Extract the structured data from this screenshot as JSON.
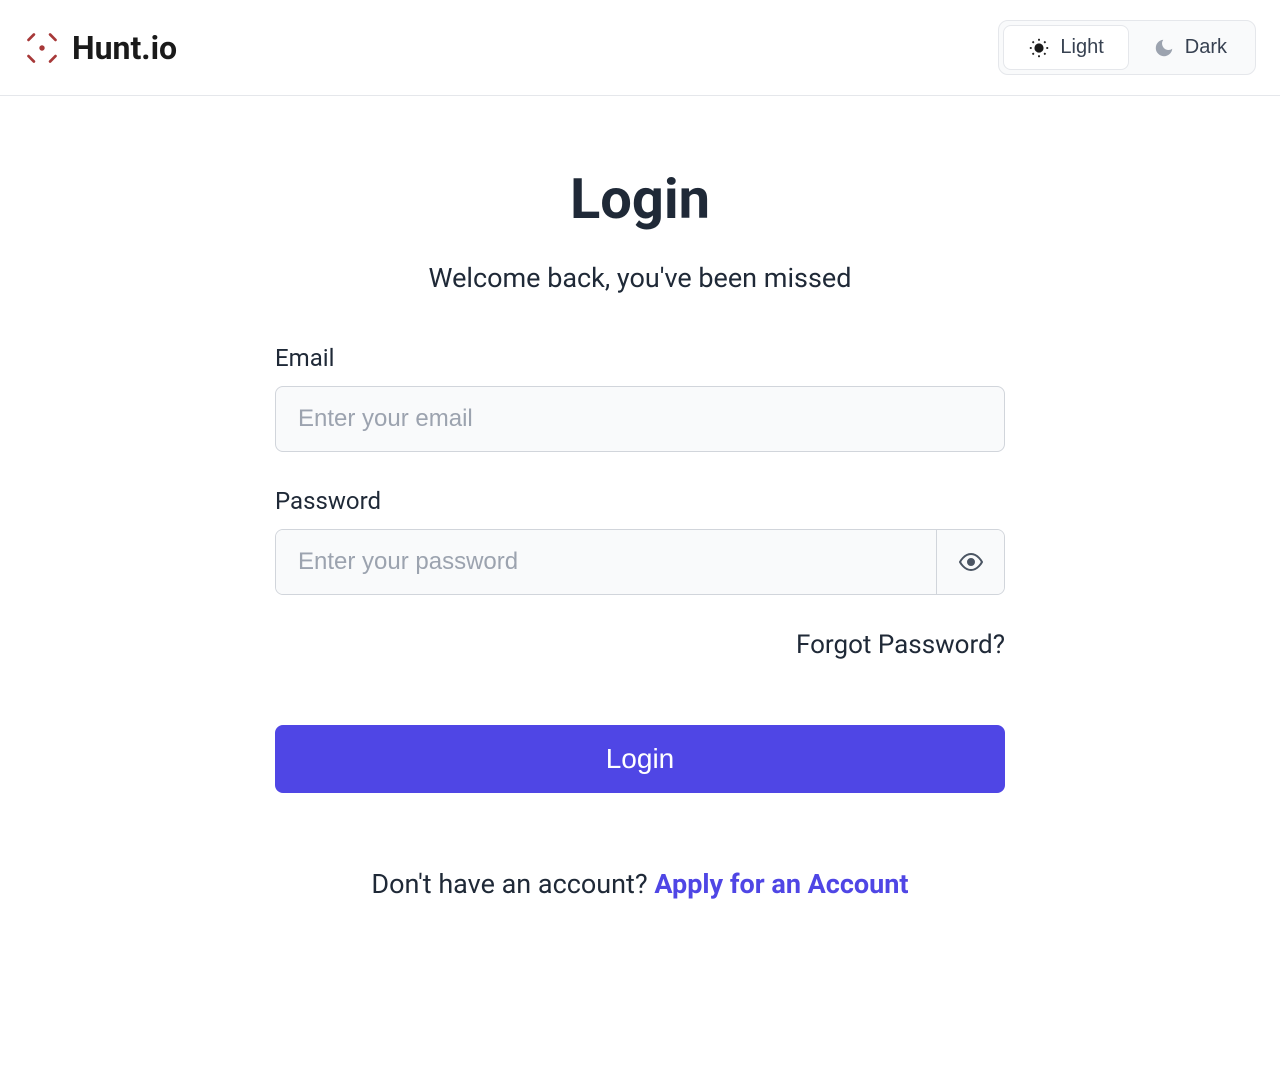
{
  "header": {
    "brand_name": "Hunt.io",
    "theme": {
      "light_label": "Light",
      "dark_label": "Dark"
    }
  },
  "login": {
    "title": "Login",
    "subtitle": "Welcome back, you've been missed",
    "email_label": "Email",
    "email_placeholder": "Enter your email",
    "password_label": "Password",
    "password_placeholder": "Enter your password",
    "forgot_password": "Forgot Password?",
    "submit_label": "Login",
    "signup_prompt": "Don't have an account? ",
    "signup_link": "Apply for an Account"
  }
}
